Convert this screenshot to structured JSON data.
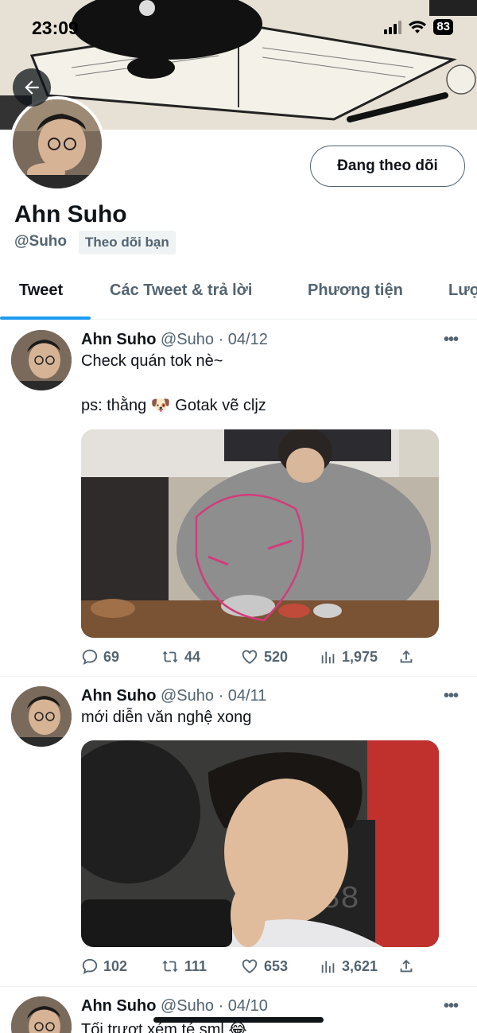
{
  "status_bar": {
    "time": "23:09",
    "battery": "83"
  },
  "profile": {
    "name": "Ahn Suho",
    "handle": "@Suho",
    "follows_you": "Theo dõi bạn",
    "follow_button": "Đang theo dõi"
  },
  "tabs": [
    "Tweet",
    "Các Tweet & trả lời",
    "Phương tiện",
    "Lượ"
  ],
  "tweets": [
    {
      "name": "Ahn Suho",
      "meta": "@Suho · 04/12",
      "line1": "Check quán tok nè~",
      "line2": "ps: thằng 🐶  Gotak vẽ cljz",
      "replies": "69",
      "retweets": "44",
      "likes": "520",
      "views": "1,975"
    },
    {
      "name": "Ahn Suho",
      "meta": "@Suho · 04/11",
      "line1": "mới diễn văn nghệ xong",
      "replies": "102",
      "retweets": "111",
      "likes": "653",
      "views": "3,621"
    },
    {
      "name": "Ahn Suho",
      "meta": "@Suho · 04/10",
      "line1": "Tối trượt xém té sml 😂"
    }
  ],
  "colors": {
    "accent": "#1d9bf0",
    "text": "#0f1419",
    "secondary": "#536471"
  }
}
